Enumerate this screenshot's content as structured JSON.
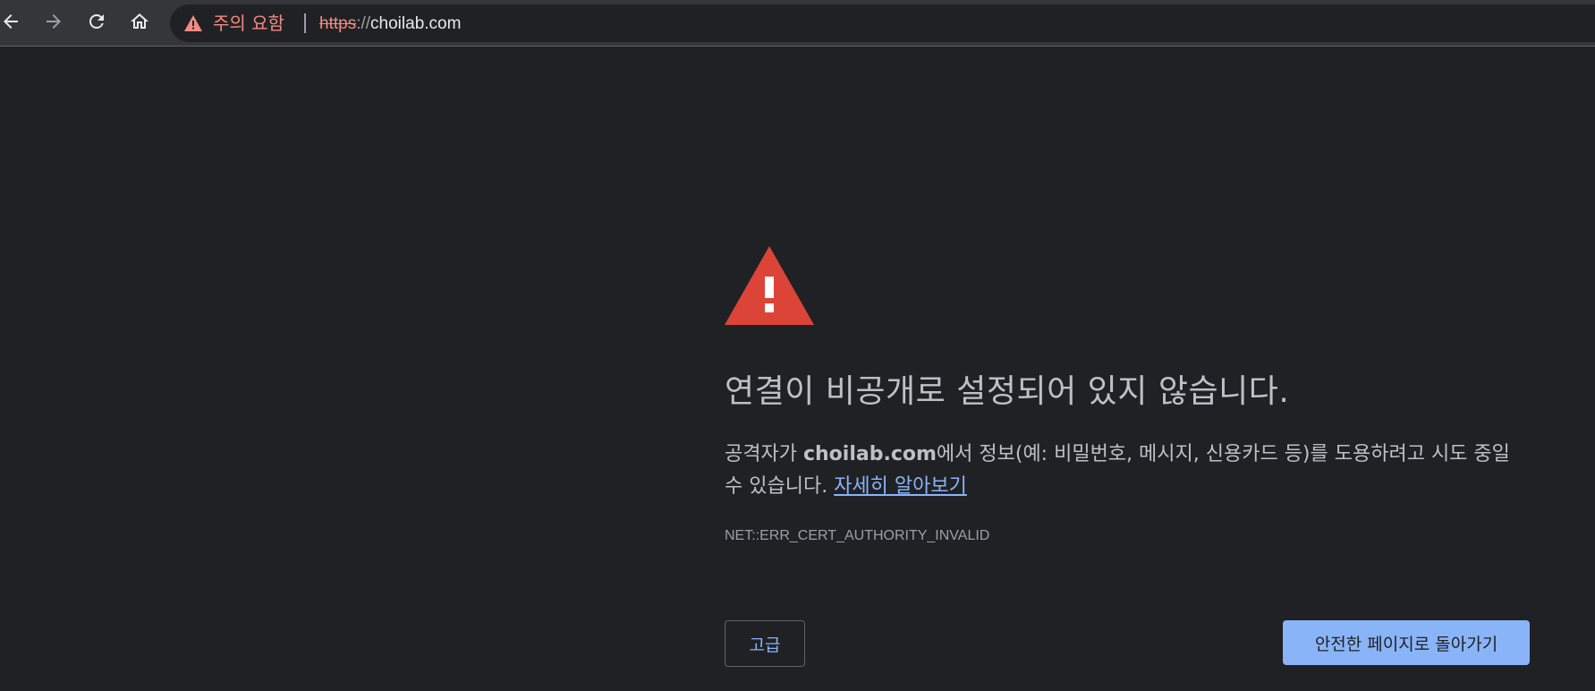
{
  "omnibox": {
    "warning_label": "주의 요함",
    "url_scheme": "https",
    "url_separator": "://",
    "url_host": "choilab.com"
  },
  "interstitial": {
    "heading": "연결이 비공개로 설정되어 있지 않습니다.",
    "message_prefix": "공격자가 ",
    "message_host": "choilab.com",
    "message_suffix": "에서 정보(예: 비밀번호, 메시지, 신용카드 등)를 도용하려고 시도 중일 수 있습니다. ",
    "learn_more": "자세히 알아보기",
    "error_code": "NET::ERR_CERT_AUTHORITY_INVALID",
    "advanced_button": "고급",
    "back_to_safety_button": "안전한 페이지로 돌아가기"
  },
  "icons": {
    "back": "arrow-left-icon",
    "forward": "arrow-right-icon",
    "reload": "reload-icon",
    "home": "home-icon",
    "warning": "warning-triangle-icon"
  },
  "colors": {
    "background": "#202124",
    "toolbar": "#35363a",
    "warning_red": "#f28b82",
    "link_blue": "#8ab4f8",
    "big_warning_red": "#db4437"
  }
}
